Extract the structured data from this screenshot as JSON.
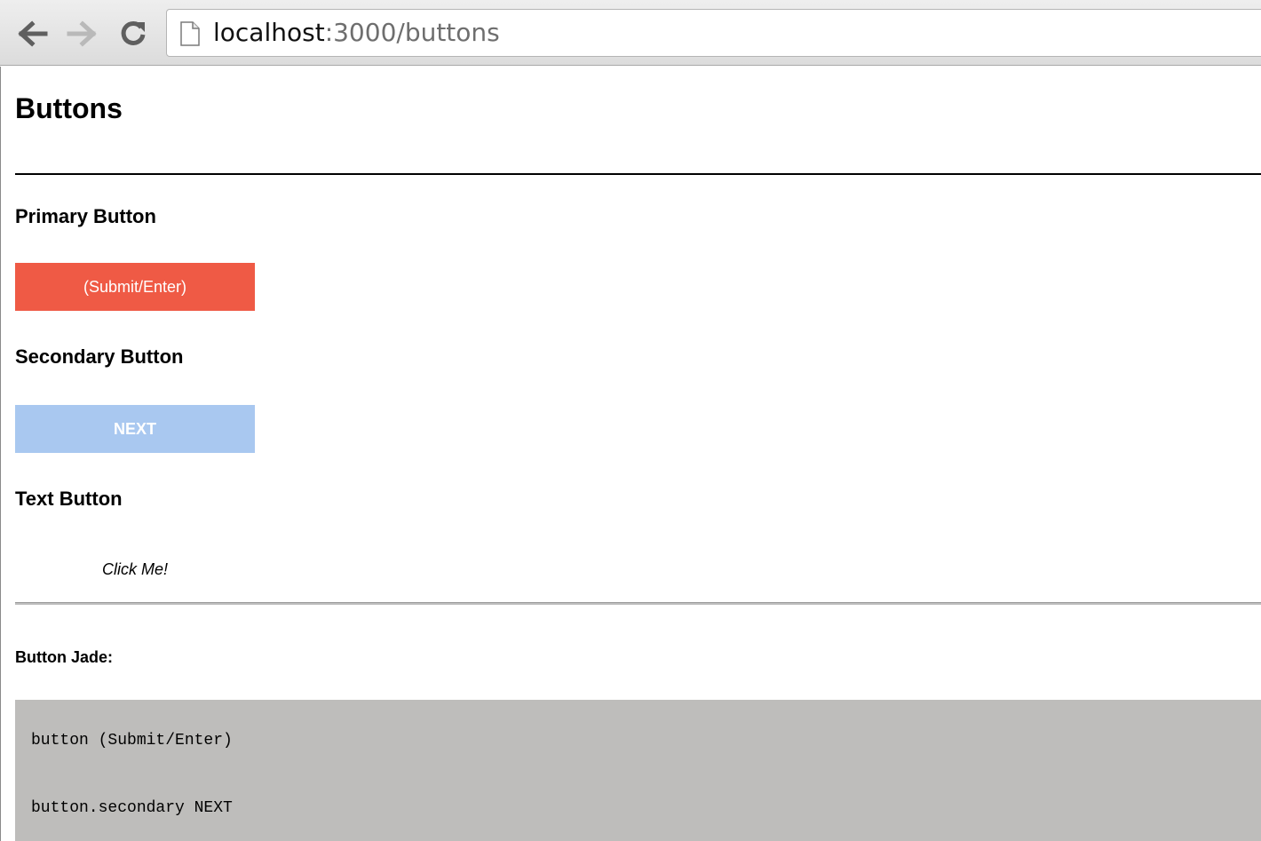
{
  "browser": {
    "url_host": "localhost",
    "url_rest": ":3000/buttons"
  },
  "page": {
    "title": "Buttons",
    "primary_heading": "Primary Button",
    "primary_button_label": "(Submit/Enter)",
    "secondary_heading": "Secondary Button",
    "secondary_button_label": "NEXT",
    "text_heading": "Text Button",
    "text_button_label": "Click Me!",
    "code_label": "Button Jade:",
    "code_lines": [
      "button (Submit/Enter)",
      "button.secondary NEXT"
    ]
  },
  "colors": {
    "primary": "#ef5a45",
    "secondary": "#a9c8f0",
    "code_background": "#bebdbb"
  },
  "icons": {
    "back": "arrow-left-icon",
    "forward": "arrow-right-icon",
    "reload": "reload-icon",
    "page": "page-icon"
  }
}
